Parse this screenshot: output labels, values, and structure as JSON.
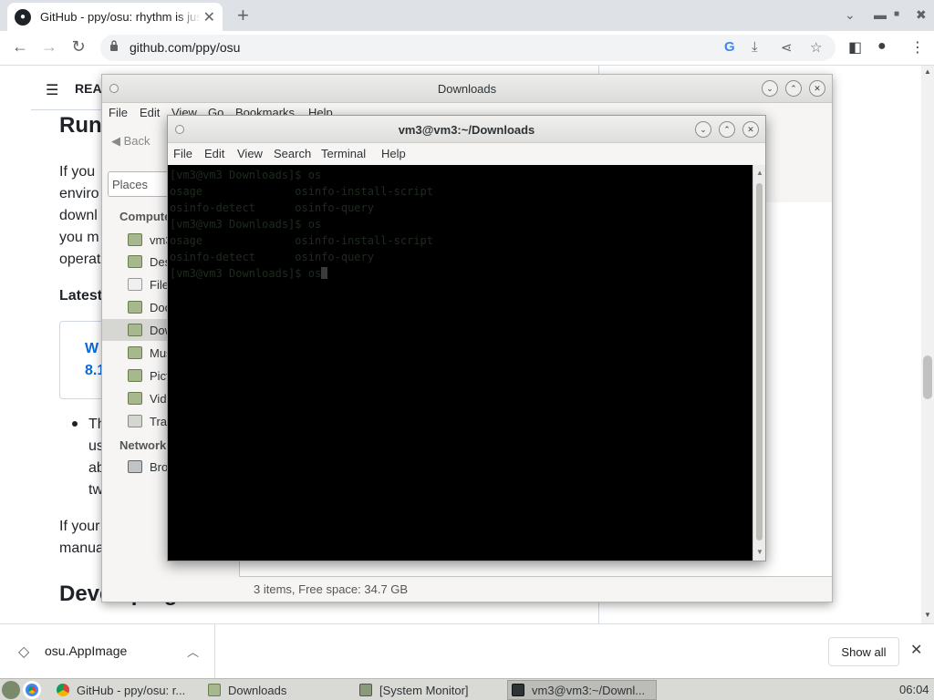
{
  "browser": {
    "tab_title": "GitHub - ppy/osu: rhythm is just a click away",
    "url": "github.com/ppy/osu",
    "new_tab_glyph": "+",
    "close_glyph": "✕"
  },
  "github_page": {
    "readme_label": "README",
    "heading_running": "Run",
    "para_lines": [
      "If you",
      "enviro",
      "downl",
      "you m",
      "operat"
    ],
    "latest_label": "Latest",
    "release_link_lines": [
      "W",
      "8.1"
    ],
    "bullet_lines": [
      "Th",
      "us",
      "ab",
      "tw"
    ],
    "para2_lines": [
      "If your",
      "manua"
    ],
    "heading_developing": "Developing a custom ruleset"
  },
  "file_manager": {
    "title": "Downloads",
    "menu": [
      "File",
      "Edit",
      "View",
      "Go",
      "Bookmarks",
      "Help"
    ],
    "back_label": "Back",
    "places_label": "Places",
    "section_computer": "Computer",
    "section_network": "Network",
    "sidebar_items": [
      "vm3",
      "Desktop",
      "File System",
      "Documents",
      "Downloads",
      "Music",
      "Pictures",
      "Videos",
      "Trash"
    ],
    "network_items": [
      "Browse Network"
    ],
    "status": "3 items, Free space: 34.7 GB"
  },
  "terminal": {
    "title": "vm3@vm3:~/Downloads",
    "menu": [
      "File",
      "Edit",
      "View",
      "Search",
      "Terminal",
      "Help"
    ],
    "lines": [
      "[vm3@vm3 Downloads]$ os",
      "osage              osinfo-install-script",
      "osinfo-detect      osinfo-query",
      "[vm3@vm3 Downloads]$ os",
      "osage              osinfo-install-script",
      "osinfo-detect      osinfo-query",
      "[vm3@vm3 Downloads]$ os"
    ]
  },
  "downloads_bar": {
    "file_name": "osu.AppImage",
    "show_all": "Show all"
  },
  "taskbar": {
    "items": [
      "GitHub - ppy/osu: r...",
      "Downloads",
      "[System Monitor]",
      "vm3@vm3:~/Downl..."
    ],
    "clock": "06:04"
  },
  "colors": {
    "link": "#0969da",
    "terminal_bg": "#000000",
    "chrome_strip": "#dee1e6"
  }
}
